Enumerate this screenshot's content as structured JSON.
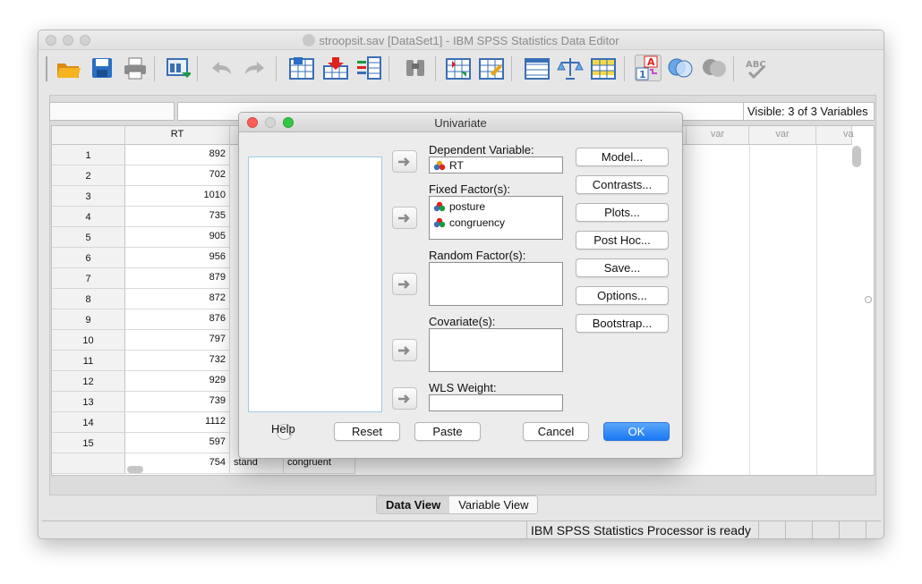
{
  "window": {
    "title": "stroopsit.sav [DataSet1] - IBM SPSS Statistics Data Editor"
  },
  "toolbar": {
    "icons": [
      "open-folder-icon",
      "save-icon",
      "print-icon",
      "dialog-recall-icon",
      "undo-icon",
      "redo-icon",
      "goto-case-icon",
      "goto-variable-icon",
      "variables-icon",
      "find-icon",
      "insert-cases-icon",
      "insert-variable-icon",
      "split-file-icon",
      "weight-cases-icon",
      "select-cases-icon",
      "value-labels-icon",
      "use-sets-icon",
      "show-all-variables-icon",
      "spell-check-icon"
    ],
    "value_labels_text": "A",
    "value_labels_num": "1",
    "spell_text": "ABC"
  },
  "visible_info": "Visible: 3 of 3 Variables",
  "grid": {
    "columns": [
      "RT"
    ],
    "var_headers": [
      "var",
      "var",
      "va"
    ],
    "rows": [
      {
        "n": "1",
        "rt": "892"
      },
      {
        "n": "2",
        "rt": "702"
      },
      {
        "n": "3",
        "rt": "1010"
      },
      {
        "n": "4",
        "rt": "735"
      },
      {
        "n": "5",
        "rt": "905"
      },
      {
        "n": "6",
        "rt": "956"
      },
      {
        "n": "7",
        "rt": "879"
      },
      {
        "n": "8",
        "rt": "872"
      },
      {
        "n": "9",
        "rt": "876"
      },
      {
        "n": "10",
        "rt": "797"
      },
      {
        "n": "11",
        "rt": "732"
      },
      {
        "n": "12",
        "rt": "929"
      },
      {
        "n": "13",
        "rt": "739"
      },
      {
        "n": "14",
        "rt": "1112"
      },
      {
        "n": "15",
        "rt": "597"
      }
    ],
    "partial_row": {
      "rt": "754",
      "posture": "stand",
      "congruency": "congruent"
    }
  },
  "view_tabs": [
    "Data View",
    "Variable View"
  ],
  "status": {
    "text": "IBM SPSS Statistics Processor is ready"
  },
  "dialog": {
    "title": "Univariate",
    "dependent_label": "Dependent Variable:",
    "dependent_value": "RT",
    "fixed_label": "Fixed Factor(s):",
    "fixed_items": [
      "posture",
      "congruency"
    ],
    "random_label": "Random Factor(s):",
    "covariate_label": "Covariate(s):",
    "wls_label": "WLS Weight:",
    "side_buttons": [
      "Model...",
      "Contrasts...",
      "Plots...",
      "Post Hoc...",
      "Save...",
      "Options...",
      "Bootstrap..."
    ],
    "help": "Help",
    "reset": "Reset",
    "paste": "Paste",
    "cancel": "Cancel",
    "ok": "OK"
  }
}
